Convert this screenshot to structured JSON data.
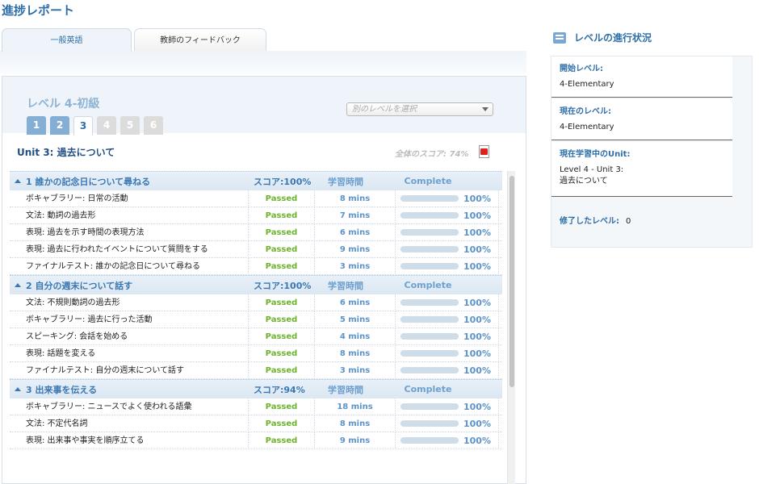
{
  "page_title": "進捗レポート",
  "tabs": [
    {
      "label": "一般英語"
    },
    {
      "label": "教師のフィードバック"
    }
  ],
  "level": {
    "title": "レベル 4-初級",
    "numbers": [
      "1",
      "2",
      "3",
      "4",
      "5",
      "6"
    ],
    "select_placeholder": "別のレベルを選択"
  },
  "unit": {
    "title": "Unit 3: 過去について",
    "overall_score": "全体のスコア: 74%"
  },
  "sections": [
    {
      "name": "1 誰かの記念日について尋ねる",
      "score": "スコア:100%",
      "time_header": "学習時間",
      "complete_header": "Complete",
      "rows": [
        {
          "name": "ボキャブラリー: 日常の活動",
          "status": "Passed",
          "time": "8 mins",
          "pct": "100%",
          "fill": 1.0
        },
        {
          "name": "文法: 動詞の過去形",
          "status": "Passed",
          "time": "7 mins",
          "pct": "100%",
          "fill": 1.0
        },
        {
          "name": "表現: 過去を示す時間の表現方法",
          "status": "Passed",
          "time": "6 mins",
          "pct": "100%",
          "fill": 1.0
        },
        {
          "name": "表現: 過去に行われたイベントについて質問をする",
          "status": "Passed",
          "time": "9 mins",
          "pct": "100%",
          "fill": 1.0
        },
        {
          "name": "ファイナルテスト: 誰かの記念日について尋ねる",
          "status": "Passed",
          "time": "3 mins",
          "pct": "100%",
          "fill": 1.0
        }
      ]
    },
    {
      "name": "2 自分の週末について話す",
      "score": "スコア:100%",
      "time_header": "学習時間",
      "complete_header": "Complete",
      "rows": [
        {
          "name": "文法: 不規則動詞の過去形",
          "status": "Passed",
          "time": "6 mins",
          "pct": "100%",
          "fill": 1.0
        },
        {
          "name": "ボキャブラリー: 過去に行った活動",
          "status": "Passed",
          "time": "5 mins",
          "pct": "100%",
          "fill": 1.0
        },
        {
          "name": "スピーキング: 会話を始める",
          "status": "Passed",
          "time": "4 mins",
          "pct": "100%",
          "fill": 1.0
        },
        {
          "name": "表現: 話題を変える",
          "status": "Passed",
          "time": "8 mins",
          "pct": "100%",
          "fill": 1.0
        },
        {
          "name": "ファイナルテスト: 自分の週末について話す",
          "status": "Passed",
          "time": "3 mins",
          "pct": "100%",
          "fill": 1.0
        }
      ]
    },
    {
      "name": "3 出来事を伝える",
      "score": "スコア:94%",
      "time_header": "学習時間",
      "complete_header": "Complete",
      "rows": [
        {
          "name": "ボキャブラリー: ニュースでよく使われる語彙",
          "status": "Passed",
          "time": "18 mins",
          "pct": "100%",
          "fill": 1.0
        },
        {
          "name": "文法: 不定代名詞",
          "status": "Passed",
          "time": "8 mins",
          "pct": "100%",
          "fill": 1.0
        },
        {
          "name": "表現: 出来事や事実を順序立てる",
          "status": "Passed",
          "time": "9 mins",
          "pct": "100%",
          "fill": 1.0
        }
      ]
    }
  ],
  "side": {
    "title": "レベルの進行状況",
    "start_label": "開始レベル:",
    "start_value": "4-Elementary",
    "current_label": "現在のレベル:",
    "current_value": "4-Elementary",
    "unit_label": "現在学習中のUnit:",
    "unit_value_1": "Level 4 - Unit 3:",
    "unit_value_2": "過去について",
    "completed_label": "修了したレベル:",
    "completed_value": "0"
  },
  "colors": {
    "accent": "#2d6ea8",
    "passed": "#6db32d",
    "time": "#5c93c9"
  }
}
